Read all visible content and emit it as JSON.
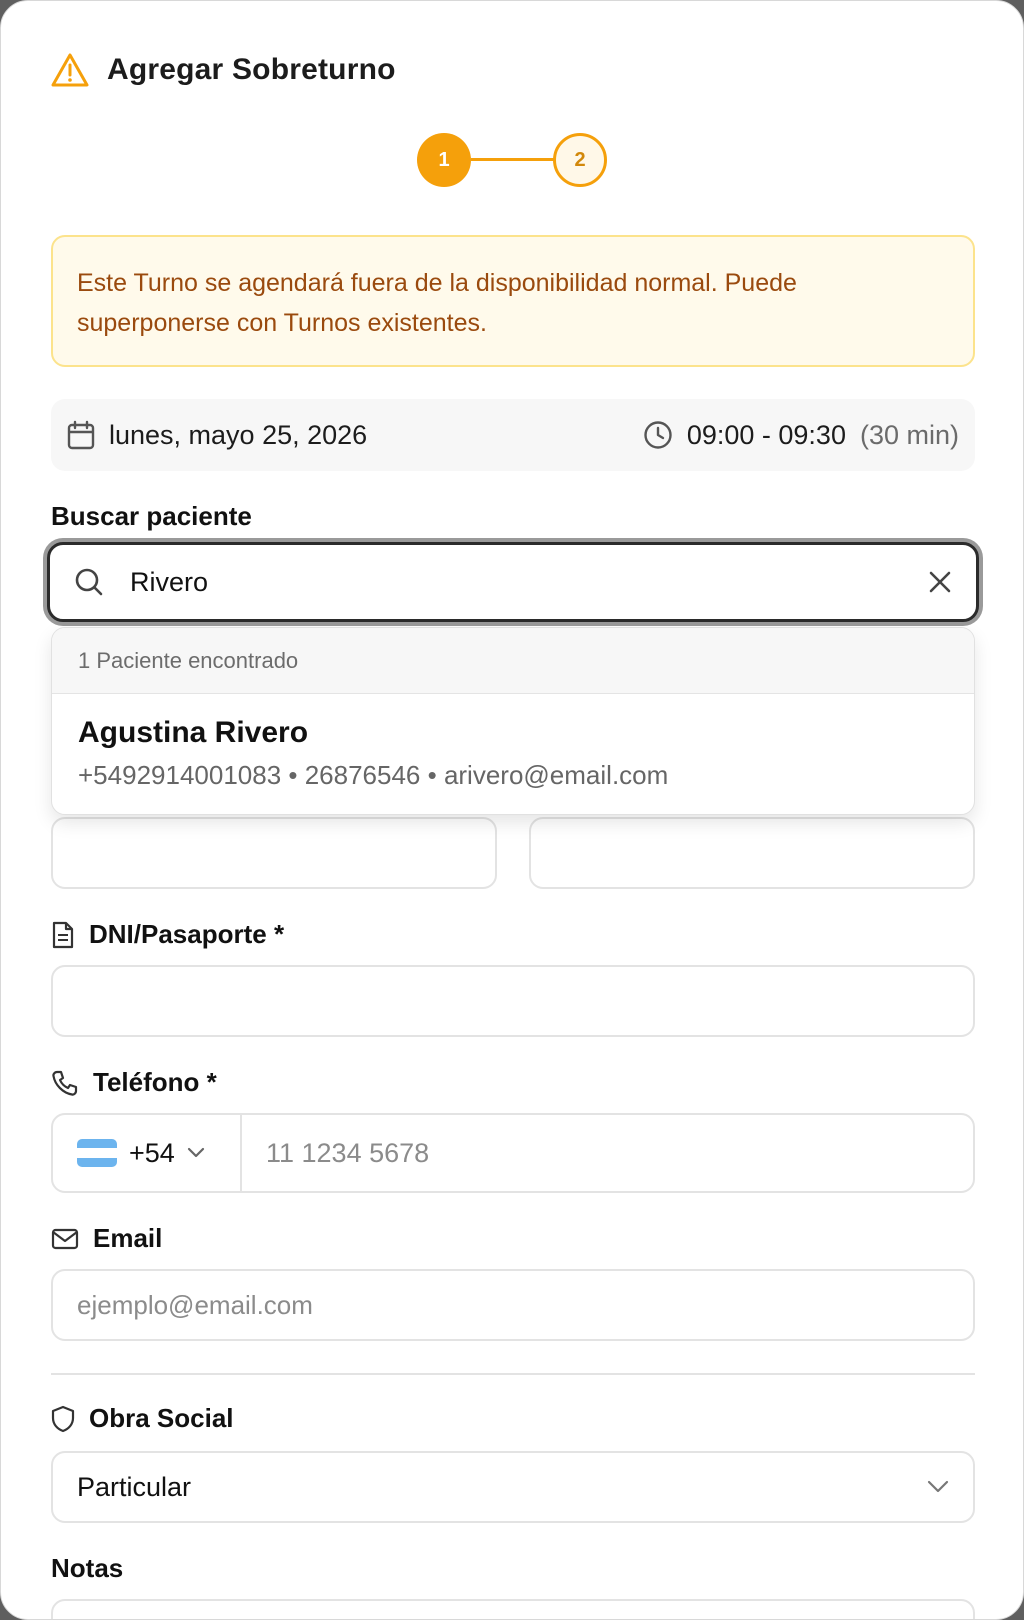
{
  "header": {
    "title": "Agregar Sobreturno",
    "icon": "warning-triangle-icon"
  },
  "stepper": {
    "steps": [
      "1",
      "2"
    ],
    "current": 1
  },
  "alert": {
    "text": "Este Turno se agendará fuera de la disponibilidad normal. Puede superponerse con Turnos existentes."
  },
  "appointment": {
    "date": "lunes, mayo 25, 2026",
    "time": "09:00 - 09:30",
    "duration": "(30 min)"
  },
  "search": {
    "label": "Buscar paciente",
    "value": "Rivero",
    "results_count": "1 Paciente encontrado",
    "results": [
      {
        "name": "Agustina Rivero",
        "meta": "+5492914001083 • 26876546 • arivero@email.com"
      }
    ]
  },
  "dni": {
    "label": "DNI/Pasaporte *"
  },
  "phone": {
    "label": "Teléfono *",
    "country_code": "+54",
    "placeholder": "11 1234 5678"
  },
  "email": {
    "label": "Email",
    "placeholder": "ejemplo@email.com"
  },
  "obra_social": {
    "label": "Obra Social",
    "value": "Particular"
  },
  "notas": {
    "label": "Notas"
  },
  "colors": {
    "accent": "#f5a00b",
    "alert_bg": "#fffaeb",
    "alert_text": "#9a4a0e"
  }
}
